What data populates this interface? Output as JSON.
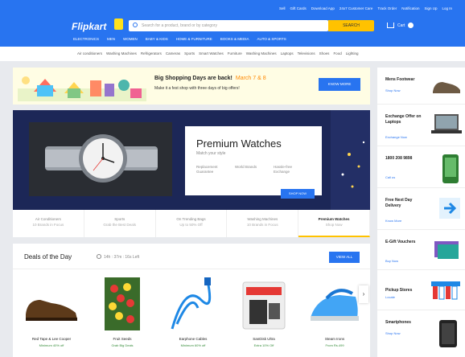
{
  "header": {
    "logo": "Flipkart",
    "top_links": [
      "Sell",
      "Gift Cards",
      "Download App",
      "24x7 Customer Care",
      "Track Order",
      "Notification",
      "Sign Up",
      "Log In"
    ],
    "search_placeholder": "Search for a product, brand or by category",
    "search_button": "SEARCH",
    "cart": "Cart",
    "categories": [
      "ELECTRONICS",
      "MEN",
      "WOMEN",
      "BABY & KIDS",
      "HOME & FURNITURE",
      "BOOKS & MEDIA",
      "AUTO & SPORTS"
    ]
  },
  "subnav": [
    "Air conditioners",
    "Washing Machines",
    "Refrigerators",
    "Cameras",
    "Sports",
    "Smart Watches",
    "Furniture",
    "Washing Machines",
    "Laptops",
    "Televisions",
    "Shoes",
    "Food",
    "Lighting"
  ],
  "banner": {
    "title": "Big Shopping Days are back!",
    "date": "March 7 & 8",
    "subtitle": "Make it a fest shop with three days of big offers!",
    "button": "KNOW MORE"
  },
  "hero": {
    "title": "Premium Watches",
    "subtitle": "Match your style",
    "features": [
      "Replacement Guarantee",
      "World Brands",
      "Hassle-free Exchange"
    ],
    "button": "SHOP NOW",
    "tabs": [
      {
        "line1": "Air Conditioners",
        "line2": "10 Brands in Focus"
      },
      {
        "line1": "Sports",
        "line2": "Grab the Best Deals"
      },
      {
        "line1": "On Trending Bags",
        "line2": "Up to 50% Off"
      },
      {
        "line1": "Washing Machines",
        "line2": "10 Brands in Focus"
      },
      {
        "line1": "Premium Watches",
        "line2": "Shop Now"
      }
    ]
  },
  "deals": {
    "title": "Deals of the Day",
    "timer": "14h : 37m : 16s Left",
    "view_all": "VIEW ALL",
    "items": [
      {
        "name": "Red Tape & Lee Cooper",
        "offer": "Minimum 40% off"
      },
      {
        "name": "Fruit Seeds",
        "offer": "Grab Big Deals"
      },
      {
        "name": "Earphone Cables",
        "offer": "Minimum 60% off"
      },
      {
        "name": "SanDisk Ultra",
        "offer": "Extra 10% Off"
      },
      {
        "name": "Steam Irons",
        "offer": "From Rs.499"
      }
    ]
  },
  "sidebar": [
    {
      "title": "Mens Footwear",
      "sub": "Shop Now"
    },
    {
      "title": "Exchange Offer on Laptops",
      "sub": "Exchange Now"
    },
    {
      "title": "1800 208 9898",
      "sub": "Call us"
    },
    {
      "title": "Free Next Day Delivery",
      "sub": "Know More"
    },
    {
      "title": "E-Gift Vouchers",
      "sub": "Buy Now"
    },
    {
      "title": "Pickup Stores",
      "sub": "Locate"
    },
    {
      "title": "Smartphones",
      "sub": "Shop Now"
    }
  ]
}
